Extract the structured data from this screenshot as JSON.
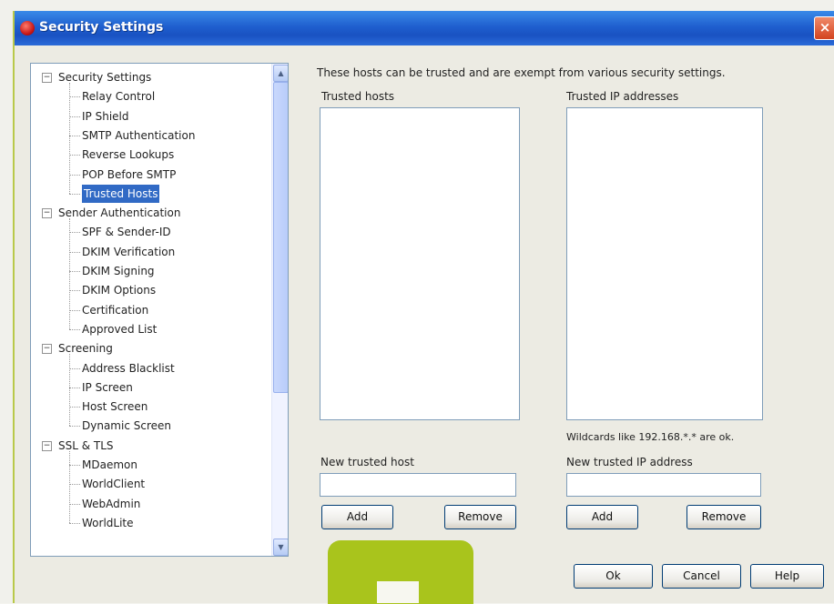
{
  "window": {
    "title": "Security Settings",
    "close_symbol": "×",
    "app_icon": "mdaemon-red-circle-icon"
  },
  "tree": {
    "groups": [
      {
        "label": "Security Settings",
        "children": [
          "Relay Control",
          "IP Shield",
          "SMTP Authentication",
          "Reverse Lookups",
          "POP Before SMTP",
          "Trusted Hosts"
        ]
      },
      {
        "label": "Sender Authentication",
        "children": [
          "SPF & Sender-ID",
          "DKIM Verification",
          "DKIM Signing",
          "DKIM Options",
          "Certification",
          "Approved List"
        ]
      },
      {
        "label": "Screening",
        "children": [
          "Address Blacklist",
          "IP Screen",
          "Host Screen",
          "Dynamic Screen"
        ]
      },
      {
        "label": "SSL & TLS",
        "children": [
          "MDaemon",
          "WorldClient",
          "WebAdmin",
          "WorldLite"
        ]
      }
    ],
    "expander_symbol": "−",
    "selected": "Trusted Hosts",
    "scroll_up_symbol": "▲",
    "scroll_down_symbol": "▼"
  },
  "main": {
    "description": "These hosts can be trusted and are exempt from various security settings.",
    "trusted_hosts_label": "Trusted hosts",
    "trusted_ips_label": "Trusted IP addresses",
    "wildcard_note": "Wildcards like 192.168.*.* are ok.",
    "new_host_label": "New trusted host",
    "new_ip_label": "New trusted IP address",
    "new_host_value": "",
    "new_ip_value": "",
    "add_label": "Add",
    "remove_label": "Remove"
  },
  "footer": {
    "ok_label": "Ok",
    "cancel_label": "Cancel",
    "help_label": "Help"
  },
  "colors": {
    "titlebar": "#1f5fcf",
    "selection": "#316ac5",
    "accent_green": "#a9c41c"
  }
}
